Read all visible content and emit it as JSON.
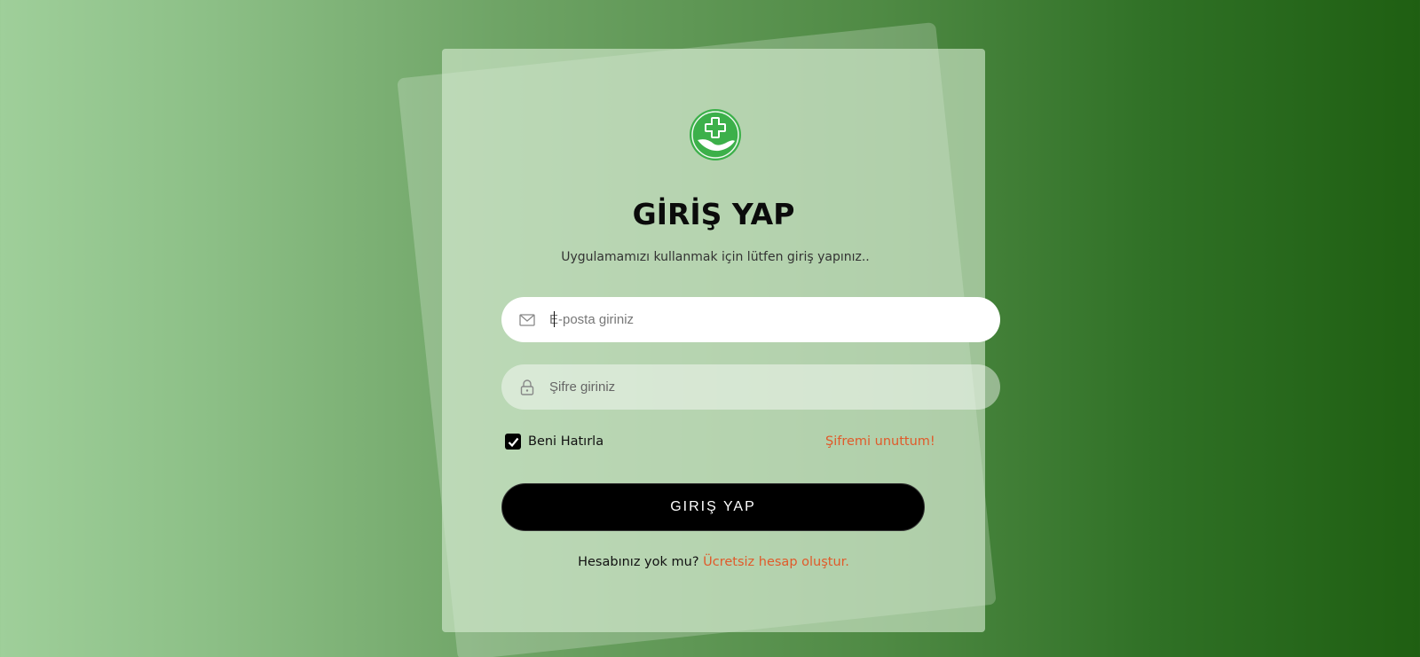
{
  "login": {
    "title": "GİRİŞ YAP",
    "subtitle": "Uygulamamızı kullanmak için lütfen giriş yapınız..",
    "email": {
      "placeholder": "E-posta giriniz",
      "value": ""
    },
    "password": {
      "placeholder": "Şifre giriniz",
      "value": ""
    },
    "remember_label": "Beni Hatırla",
    "remember_checked": true,
    "forgot_label": "Şifremi unuttum!",
    "submit_label": "GIRIŞ YAP",
    "signup_prompt": "Hesabınız yok mu?",
    "signup_link": "Ücretsiz hesap oluştur."
  },
  "icons": {
    "logo": "health-hand-cross-icon",
    "email": "envelope-icon",
    "password": "lock-icon",
    "checkbox": "checkmark-icon"
  },
  "colors": {
    "accent": "#e05a2a",
    "logo_green": "#3cb04a",
    "button_bg": "#000000"
  }
}
